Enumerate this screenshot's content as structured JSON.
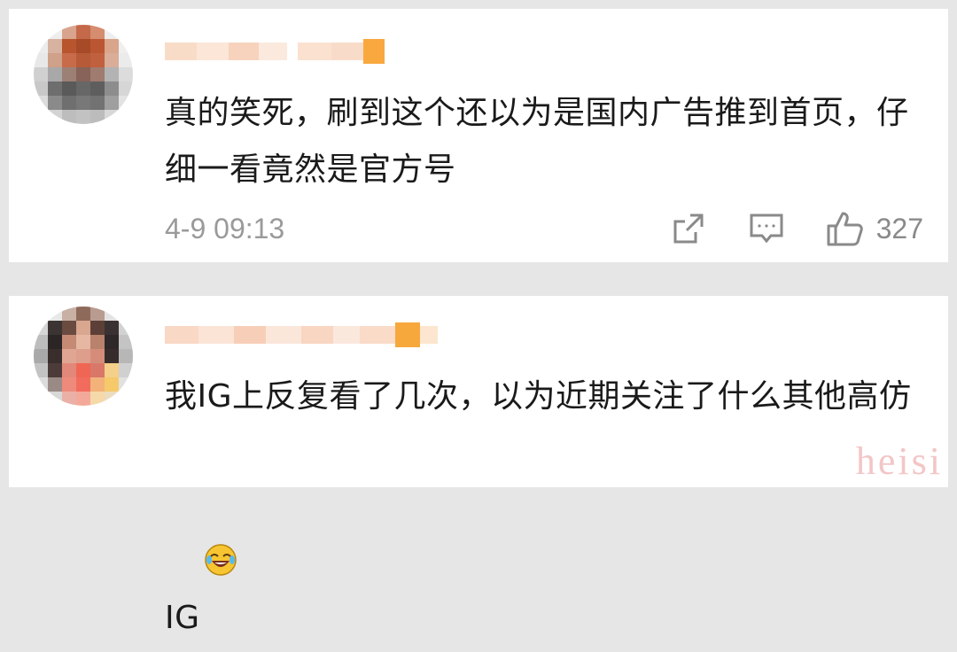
{
  "comments": [
    {
      "text": "真的笑死，刷到这个还以为是国内广告推到首页，仔细一看竟然是官方号",
      "timestamp": "4-9 09:13",
      "likes": "327"
    },
    {
      "text": "我IG上反复看了几次，以为近期关注了什么其他高仿IG",
      "emoji": "laughing-crying-emoji"
    }
  ],
  "icons": {
    "share": "share-icon",
    "comment": "comment-icon",
    "like": "thumbs-up-icon"
  },
  "watermark": "heisi",
  "colors": {
    "background": "#e6e6e6",
    "card": "#ffffff",
    "text": "#1a1a1a",
    "meta": "#9a9a9a",
    "watermark": "#f3c6c6"
  }
}
